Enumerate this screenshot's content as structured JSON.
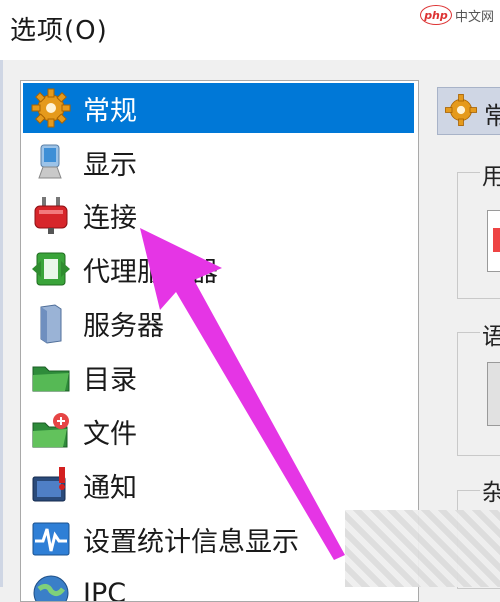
{
  "window": {
    "title": "选项(O)"
  },
  "watermark": {
    "brand": "php",
    "site": "中文网"
  },
  "tree": {
    "items": [
      {
        "label": "常规",
        "icon": "gear-icon",
        "selected": true
      },
      {
        "label": "显示",
        "icon": "monitor-icon",
        "selected": false
      },
      {
        "label": "连接",
        "icon": "plug-icon",
        "selected": false
      },
      {
        "label": "代理服务器",
        "icon": "proxy-icon",
        "selected": false
      },
      {
        "label": "服务器",
        "icon": "server-icon",
        "selected": false
      },
      {
        "label": "目录",
        "icon": "folder-icon",
        "selected": false
      },
      {
        "label": "文件",
        "icon": "file-icon",
        "selected": false
      },
      {
        "label": "通知",
        "icon": "notify-icon",
        "selected": false
      },
      {
        "label": "设置统计信息显示",
        "icon": "stats-icon",
        "selected": false
      },
      {
        "label": "IPC",
        "icon": "globe-icon",
        "selected": false
      }
    ]
  },
  "panel": {
    "header": "常",
    "groups": [
      {
        "label": "用"
      },
      {
        "label": "语"
      },
      {
        "label": "杂"
      }
    ]
  },
  "colors": {
    "selection": "#0078d7",
    "arrow": "#e535e5"
  }
}
